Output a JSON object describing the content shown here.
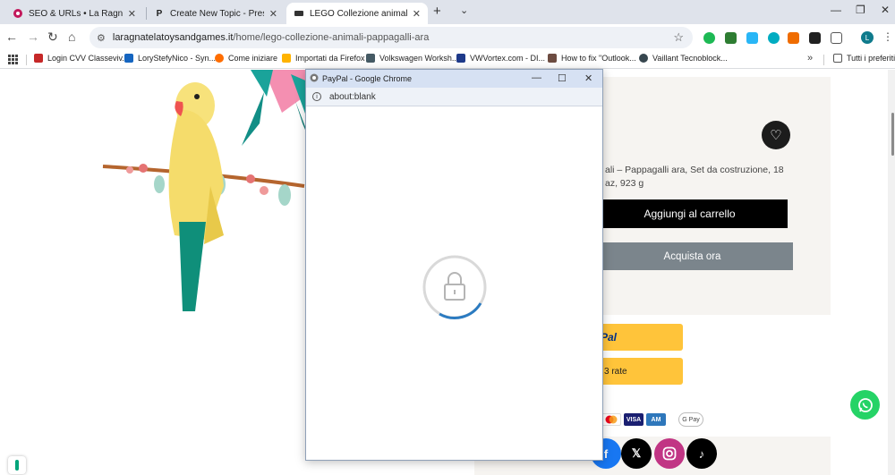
{
  "tabs": [
    {
      "title": "SEO & URLs • La Ragnatela Toy",
      "favicon_color": "#c2185b"
    },
    {
      "title": "Create New Topic - PrestaShop",
      "favicon_color": "#1f1f1f"
    },
    {
      "title": "LEGO Collezione animali – Papp",
      "favicon_color": "#333333"
    }
  ],
  "address": {
    "host": "laragnatelatoysandgames.it",
    "path": "/home/lego-collezione-animali-pappagalli-ara"
  },
  "profile_initial": "L",
  "bookmarks": [
    {
      "label": "Login CVV Classeviv...",
      "color": "#c62828"
    },
    {
      "label": "LoryStefyNico - Syn...",
      "color": "#1565c0"
    },
    {
      "label": "Come iniziare",
      "color": "#ff6d00"
    },
    {
      "label": "Importati da Firefox",
      "color": "#ffb300"
    },
    {
      "label": "Volkswagen Worksh...",
      "color": "#455a64"
    },
    {
      "label": "VWVortex.com - DI...",
      "color": "#1e3a8a"
    },
    {
      "label": "How to fix \"Outlook...",
      "color": "#6d4c41"
    },
    {
      "label": "Vaillant Tecnoblock...",
      "color": "#37474f"
    }
  ],
  "bookmarks_more": "»",
  "bookmarks_folder": "Tutti i preferiti",
  "product": {
    "description": "ali – Pappagalli ara, Set da costruzione, 18 az, 923 g",
    "add_to_cart": "Aggiungi al carrello",
    "buy_now": "Acquista ora",
    "paypal_label": "Pal",
    "paypal_installments": "3 rate",
    "gpay": "G Pay"
  },
  "popup": {
    "title": "PayPal - Google Chrome",
    "url": "about:blank"
  },
  "colors": {
    "accent_paypal": "#ffc43a",
    "whatsapp": "#25d366",
    "instagram": "#c13584"
  }
}
